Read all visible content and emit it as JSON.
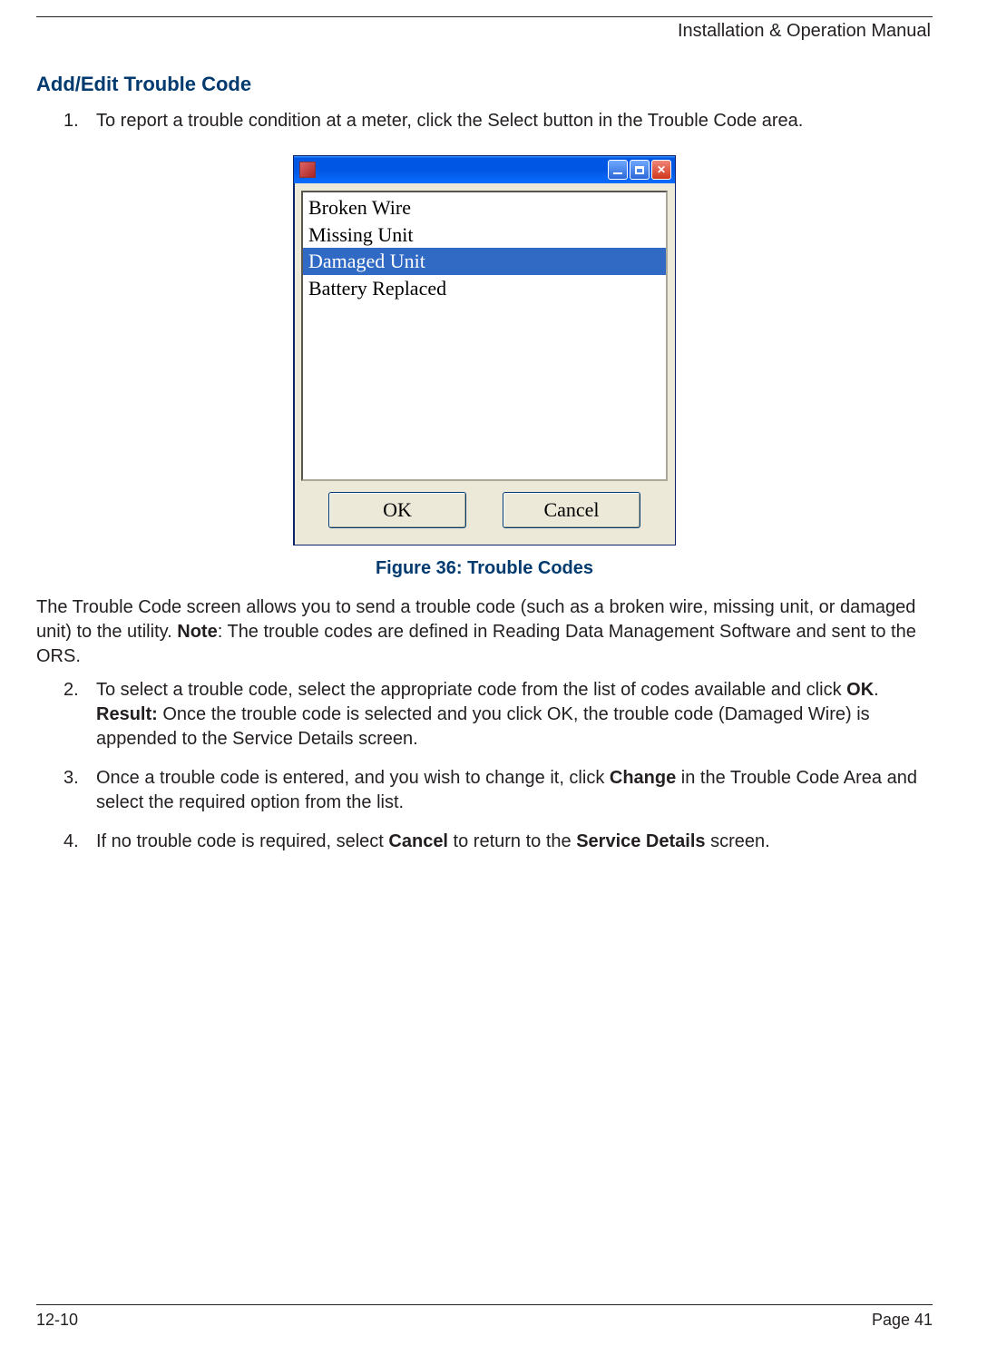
{
  "header": {
    "doc_title": "Installation & Operation Manual"
  },
  "section": {
    "title": "Add/Edit Trouble Code"
  },
  "steps": {
    "s1_num": "1.",
    "s1": "To report a trouble condition at a meter, click the Select button in the Trouble Code area.",
    "s2_num": "2.",
    "s2_a": "To select a trouble code, select the appropriate code from the list of codes available and click ",
    "s2_ok": "OK",
    "s2_b": ".",
    "s2_result_label": "Result:",
    "s2_result_text": "  Once the trouble code is selected and you click OK, the trouble code (Damaged Wire) is appended to the Service Details screen.",
    "s3_num": "3.",
    "s3_a": "Once a trouble code is entered, and you wish to change it, click ",
    "s3_change": "Change",
    "s3_b": " in the Trouble Code Area and select the required option from the list.",
    "s4_num": "4.",
    "s4_a": "If  no trouble code is required, select ",
    "s4_cancel": "Cancel",
    "s4_b": " to return to the ",
    "s4_sd": "Service Details",
    "s4_c": " screen."
  },
  "paragraph": {
    "a": "The Trouble Code screen allows you to send a trouble code (such as a broken wire, missing unit, or damaged unit) to the utility. ",
    "note_label": "Note",
    "b": ": The trouble codes are defined in Reading Data Management Software and sent to the ORS."
  },
  "figure": {
    "caption": "Figure 36:  Trouble Codes"
  },
  "dialog": {
    "items": {
      "i0": "Broken Wire",
      "i1": "Missing Unit",
      "i2": "Damaged Unit",
      "i3": "Battery Replaced"
    },
    "ok_label": "OK",
    "cancel_label": "Cancel"
  },
  "footer": {
    "left": "12-10",
    "right": "Page 41"
  }
}
